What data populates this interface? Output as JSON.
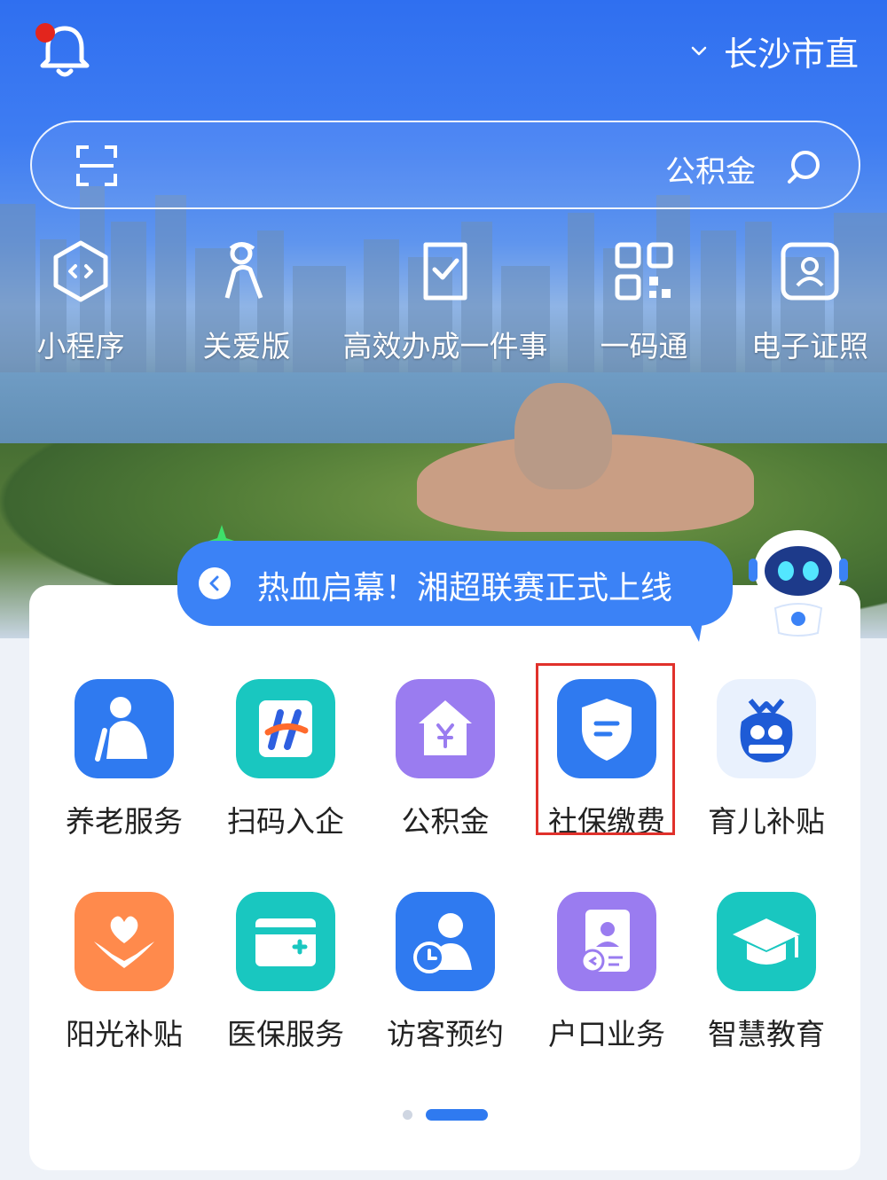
{
  "header": {
    "city": "长沙市直",
    "has_notification": true,
    "accent": "#2f6ff0"
  },
  "search": {
    "placeholder": "公积金"
  },
  "quick_links": [
    {
      "label": "电子证照",
      "icon": "id-card-icon"
    },
    {
      "label": "一码通",
      "icon": "qr-grid-icon"
    },
    {
      "label": "高效办成一件事",
      "icon": "document-check-icon"
    },
    {
      "label": "关爱版",
      "icon": "elderly-care-icon"
    },
    {
      "label": "小程序",
      "icon": "mini-program-icon"
    }
  ],
  "banner": {
    "text": "热血启幕！湘超联赛正式上线"
  },
  "services": [
    {
      "label": "育儿补贴",
      "icon": "childcare-bag-icon",
      "color": "#e9f1fd",
      "highlighted": false
    },
    {
      "label": "社保缴费",
      "icon": "shield-icon",
      "color": "#2f7af0",
      "highlighted": true
    },
    {
      "label": "公积金",
      "icon": "house-yuan-icon",
      "color": "#9a7cf0",
      "highlighted": false
    },
    {
      "label": "扫码入企",
      "icon": "h-logo-icon",
      "color": "#19c7c0",
      "highlighted": false
    },
    {
      "label": "养老服务",
      "icon": "elderly-icon",
      "color": "#2f7af0",
      "highlighted": false
    },
    {
      "label": "智慧教育",
      "icon": "graduation-cap-icon",
      "color": "#19c7c0",
      "highlighted": false
    },
    {
      "label": "户口业务",
      "icon": "household-register-icon",
      "color": "#9a7cf0",
      "highlighted": false
    },
    {
      "label": "访客预约",
      "icon": "visitor-clock-icon",
      "color": "#2f7af0",
      "highlighted": false
    },
    {
      "label": "医保服务",
      "icon": "medical-card-icon",
      "color": "#19c7c0",
      "highlighted": false
    },
    {
      "label": "阳光补贴",
      "icon": "heart-hands-icon",
      "color": "#ff8a4c",
      "highlighted": false
    }
  ],
  "pager": {
    "current": 2,
    "total": 2
  }
}
